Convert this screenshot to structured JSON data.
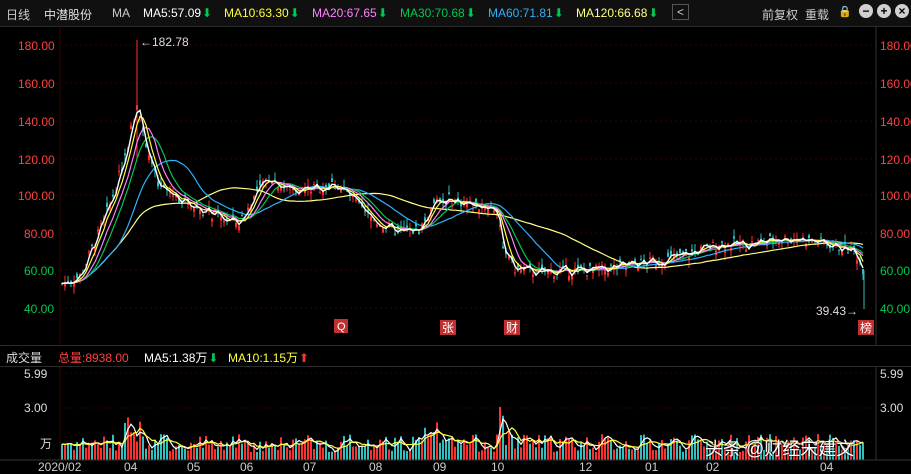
{
  "toolbar": {
    "period": "日线",
    "stock_name": "中潜股份",
    "ma_label": "MA",
    "ma5": "MA5:57.09",
    "ma10": "MA10:63.30",
    "ma20": "MA20:67.65",
    "ma30": "MA30:70.68",
    "ma60": "MA60:71.81",
    "ma120": "MA120:66.68",
    "back": "<",
    "adjust": "前复权",
    "overlay": "重载",
    "lock": "🔒",
    "minus": "−",
    "plus": "+",
    "close": "×"
  },
  "price_axis": {
    "ticks": [
      "180.00",
      "160.00",
      "140.00",
      "120.00",
      "100.00",
      "80.00",
      "60.00",
      "40.00"
    ],
    "high_label": "←182.78",
    "low_label": "39.43→"
  },
  "markers": {
    "m1": "Q",
    "m2": "张",
    "m3": "财",
    "m4": "榜"
  },
  "volume_bar": {
    "title": "成交量",
    "total": "总量:8938.00",
    "vma5": "MA5:1.38万",
    "vma10": "MA10:1.15万"
  },
  "volume_axis": {
    "ticks": [
      "5.99",
      "3.00"
    ],
    "unit": "万"
  },
  "date_axis": [
    "2020/02",
    "04",
    "05",
    "06",
    "07",
    "08",
    "09",
    "10",
    "12",
    "01",
    "02",
    "04"
  ],
  "watermark": "头条 @财经宋建文",
  "colors": {
    "ma5": "#ffffff",
    "ma10": "#ffff40",
    "ma20": "#ff80ff",
    "ma30": "#00c850",
    "ma60": "#30b0ff",
    "ma120": "#ffff80",
    "up": "#ff3030",
    "down": "#30c0c0"
  }
}
